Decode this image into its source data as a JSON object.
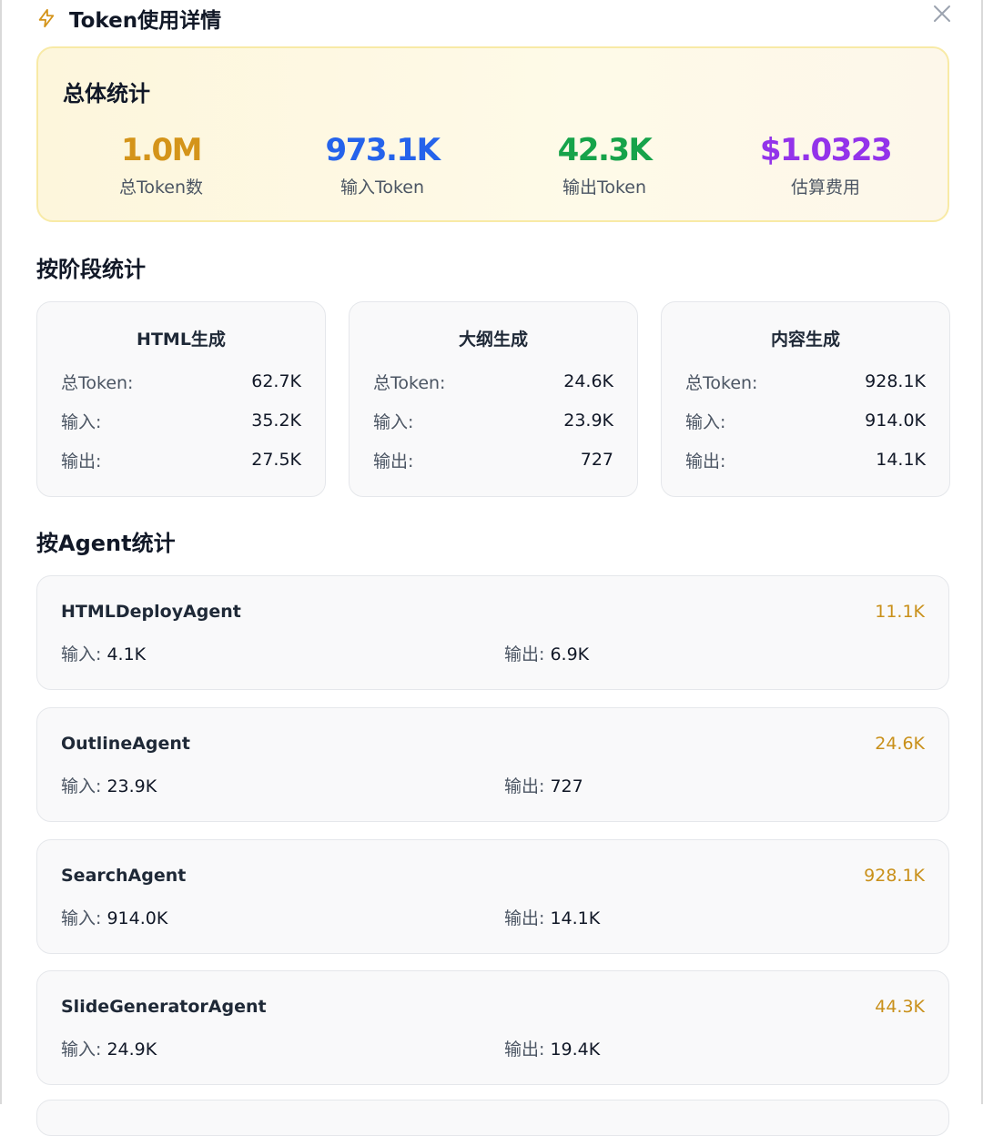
{
  "header": {
    "title": "Token使用详情"
  },
  "overview": {
    "title": "总体统计",
    "stats": [
      {
        "value": "1.0M",
        "label": "总Token数",
        "color": "#d4941a"
      },
      {
        "value": "973.1K",
        "label": "输入Token",
        "color": "#2563eb"
      },
      {
        "value": "42.3K",
        "label": "输出Token",
        "color": "#16a34a"
      },
      {
        "value": "$1.0323",
        "label": "估算费用",
        "color": "#9333ea"
      }
    ]
  },
  "stages": {
    "title": "按阶段统计",
    "labels": {
      "total": "总Token:",
      "input": "输入:",
      "output": "输出:"
    },
    "items": [
      {
        "name": "HTML生成",
        "total": "62.7K",
        "input": "35.2K",
        "output": "27.5K"
      },
      {
        "name": "大纲生成",
        "total": "24.6K",
        "input": "23.9K",
        "output": "727"
      },
      {
        "name": "内容生成",
        "total": "928.1K",
        "input": "914.0K",
        "output": "14.1K"
      }
    ]
  },
  "agents": {
    "title": "按Agent统计",
    "labels": {
      "input": "输入: ",
      "output": "输出: "
    },
    "items": [
      {
        "name": "HTMLDeployAgent",
        "total": "11.1K",
        "input": "4.1K",
        "output": "6.9K"
      },
      {
        "name": "OutlineAgent",
        "total": "24.6K",
        "input": "23.9K",
        "output": "727"
      },
      {
        "name": "SearchAgent",
        "total": "928.1K",
        "input": "914.0K",
        "output": "14.1K"
      },
      {
        "name": "SlideGeneratorAgent",
        "total": "44.3K",
        "input": "24.9K",
        "output": "19.4K"
      }
    ]
  },
  "icons": {
    "header_icon": "lightning-bolt-icon",
    "close_icon": "close-icon",
    "accent_color": "#c9901a"
  }
}
